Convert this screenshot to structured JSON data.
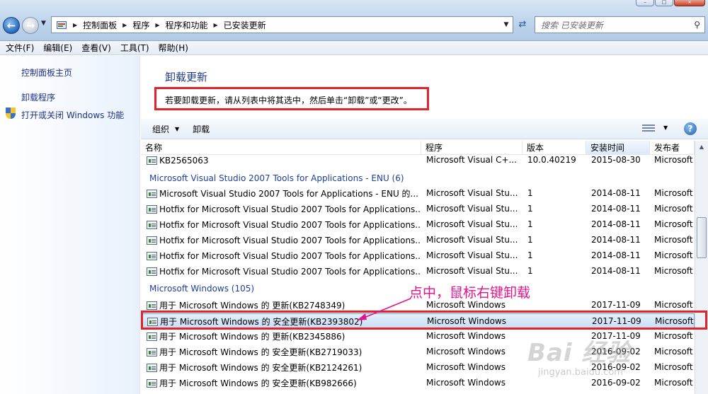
{
  "window": {
    "min": "–",
    "max": "□",
    "close": "×"
  },
  "address_bar": {
    "crumbs": [
      "控制面板",
      "程序",
      "程序和功能",
      "已安装更新"
    ],
    "search_placeholder": "搜索 已安装更新"
  },
  "menu": [
    "文件(F)",
    "编辑(E)",
    "查看(V)",
    "工具(T)",
    "帮助(H)"
  ],
  "left_pane": {
    "home": "控制面板主页",
    "uninstall_program": "卸载程序",
    "windows_features": "打开或关闭 Windows 功能"
  },
  "main": {
    "title": "卸载更新",
    "instruction": "若要卸载更新，请从列表中将其选中，然后单击“卸载”或“更改”。"
  },
  "toolbar": {
    "organize": "组织",
    "uninstall": "卸载",
    "help": "?"
  },
  "columns": [
    "名称",
    "程序",
    "版本",
    "安装时间",
    "发布者"
  ],
  "rows": [
    {
      "type": "item",
      "name": "KB2565063",
      "program": "Microsoft Visual C+...",
      "version": "10.0.40219",
      "date": "2015-08-30",
      "publisher": "Microsoft"
    },
    {
      "type": "group",
      "name": "Microsoft Visual Studio 2007 Tools for Applications - ENU (6)"
    },
    {
      "type": "item",
      "name": "Microsoft Visual Studio 2007 Tools for Applications - ENU 的...",
      "program": "Microsoft Visual Stu...",
      "version": "1",
      "date": "2014-08-11",
      "publisher": "Microsoft"
    },
    {
      "type": "item",
      "name": "Hotfix for Microsoft Visual Studio 2007 Tools for Applications...",
      "program": "Microsoft Visual Stu...",
      "version": "1",
      "date": "2014-08-11",
      "publisher": "Microsoft"
    },
    {
      "type": "item",
      "name": "Hotfix for Microsoft Visual Studio 2007 Tools for Applications...",
      "program": "Microsoft Visual Stu...",
      "version": "1",
      "date": "2014-08-11",
      "publisher": "Microsoft"
    },
    {
      "type": "item",
      "name": "Hotfix for Microsoft Visual Studio 2007 Tools for Applications...",
      "program": "Microsoft Visual Stu...",
      "version": "1",
      "date": "2014-08-11",
      "publisher": "Microsoft"
    },
    {
      "type": "item",
      "name": "Hotfix for Microsoft Visual Studio 2007 Tools for Applications...",
      "program": "Microsoft Visual Stu...",
      "version": "1",
      "date": "2014-08-11",
      "publisher": "Microsoft"
    },
    {
      "type": "item",
      "name": "Hotfix for Microsoft Visual Studio 2007 Tools for Applications...",
      "program": "Microsoft Visual Stu...",
      "version": "1",
      "date": "2014-08-11",
      "publisher": "Microsoft"
    },
    {
      "type": "group",
      "name": "Microsoft Windows (105)"
    },
    {
      "type": "item",
      "name": "用于 Microsoft Windows 的 更新(KB2748349)",
      "program": "Microsoft Windows",
      "version": "",
      "date": "2017-11-09",
      "publisher": "Microsoft"
    },
    {
      "type": "item",
      "selected": true,
      "name": "用于 Microsoft Windows 的 安全更新(KB2393802)",
      "program": "Microsoft Windows",
      "version": "",
      "date": "2017-11-09",
      "publisher": "Microsoft"
    },
    {
      "type": "item",
      "name": "用于 Microsoft Windows 的 更新(KB2345886)",
      "program": "Microsoft Windows",
      "version": "",
      "date": "2017-11-09",
      "publisher": "Microsoft"
    },
    {
      "type": "item",
      "name": "用于 Microsoft Windows 的 安全更新(KB2719033)",
      "program": "Microsoft Windows",
      "version": "",
      "date": "2016-09-02",
      "publisher": "Microsoft"
    },
    {
      "type": "item",
      "name": "用于 Microsoft Windows 的 安全更新(KB2124261)",
      "program": "Microsoft Windows",
      "version": "",
      "date": "2016-09-02",
      "publisher": "Microsoft"
    },
    {
      "type": "item",
      "name": "用于 Microsoft Windows 的 安全更新(KB982666)",
      "program": "Microsoft Windows",
      "version": "",
      "date": "2016-09-02",
      "publisher": "Microsoft"
    }
  ],
  "annotation": {
    "text": "点中，鼠标右键卸载",
    "color": "#e4138c",
    "box_color": "#e2232a"
  },
  "watermark": {
    "text": "Bai 经验",
    "sub": "jingyan.baidu.com"
  }
}
